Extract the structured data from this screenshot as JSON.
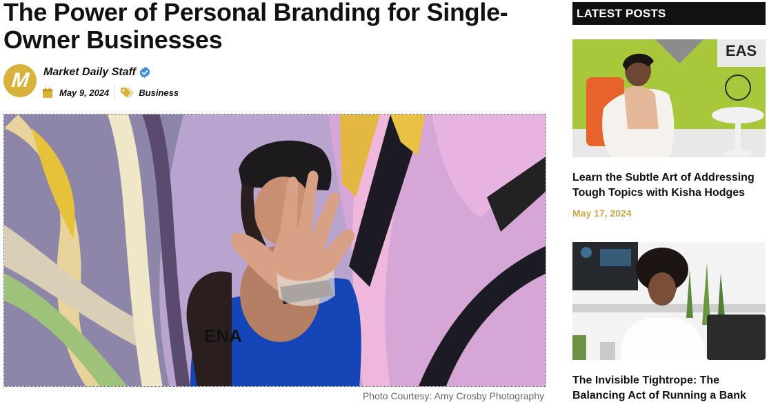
{
  "article": {
    "title": "The Power of Personal Branding for Single-Owner Businesses",
    "author": "Market Daily Staff",
    "avatar_letter": "M",
    "date": "May 9, 2024",
    "category": "Business",
    "image_caption": "Photo Courtesy: Amy Crosby Photography"
  },
  "sidebar": {
    "heading": "LATEST POSTS",
    "posts": [
      {
        "title": "Learn the Subtle Art of Addressing Tough Topics with Kisha Hodges",
        "date": "May 17, 2024"
      },
      {
        "title": "The Invisible Tightrope: The Balancing Act of Running a Bank"
      }
    ]
  },
  "colors": {
    "accent_gold": "#d8b33b",
    "date_gold": "#c9a84a",
    "verified_blue": "#3b8de0",
    "header_black": "#111111"
  },
  "icons": [
    "verified-badge-icon",
    "calendar-icon",
    "tag-icon"
  ]
}
